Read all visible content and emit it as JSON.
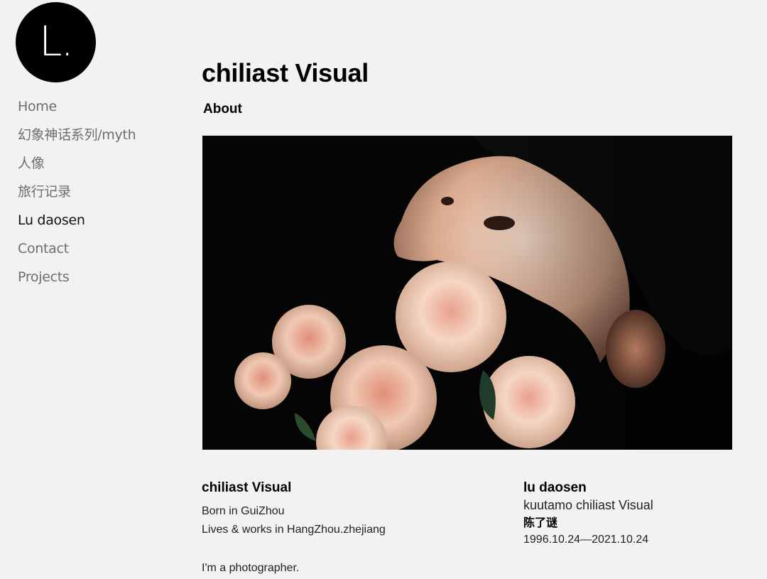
{
  "logo": {
    "text": "L."
  },
  "sidebar": {
    "items": [
      {
        "label": "Home"
      },
      {
        "label": "幻象神话系列/myth"
      },
      {
        "label": "人像"
      },
      {
        "label": "旅行记录"
      },
      {
        "label": "Lu daosen"
      },
      {
        "label": "Contact"
      },
      {
        "label": "Projects"
      }
    ],
    "active_label": "Lu daosen"
  },
  "header": {
    "site_title": "chiliast Visual",
    "tab_label": "About"
  },
  "hero_image": {
    "subject": "portrait-with-roses",
    "background_color": "#050505"
  },
  "bio": {
    "left": {
      "heading": "chiliast Visual",
      "born": "Born in GuiZhou",
      "lives": "Lives & works in HangZhou.zhejiang",
      "intro": "I'm a photographer."
    },
    "right": {
      "name": "lu daosen",
      "subtitle": "kuutamo chiliast Visual",
      "chinese_name": "陈了谜",
      "dates": "1996.10.24—2021.10.24"
    }
  },
  "colors": {
    "page_background": "#f2f2f2",
    "nav_inactive": "#6e6e6e",
    "nav_active": "#111111",
    "logo_background": "#000000"
  }
}
